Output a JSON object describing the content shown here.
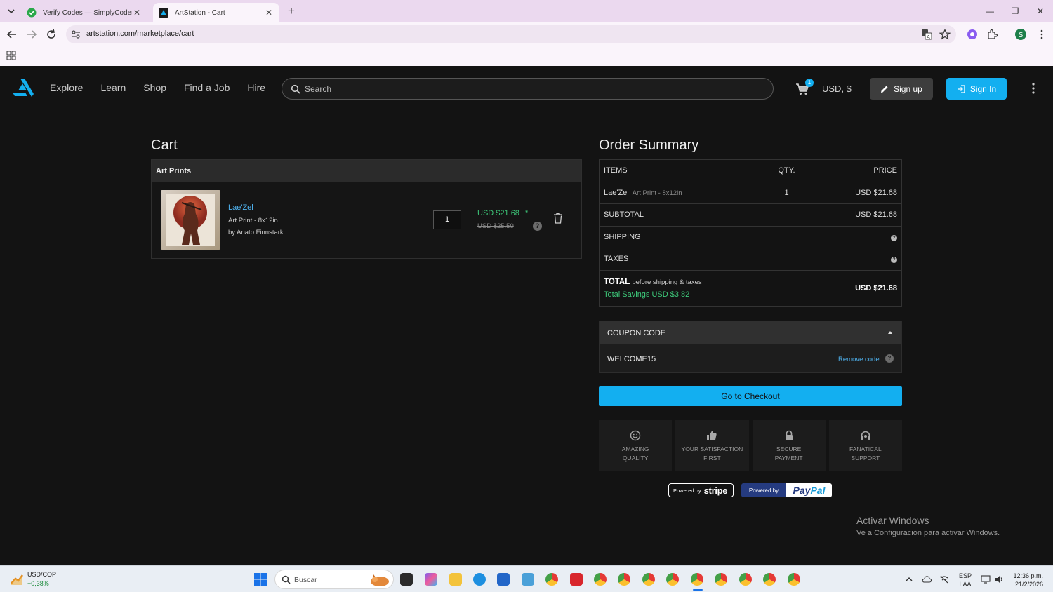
{
  "browser": {
    "tabs": [
      {
        "title": "Verify Codes — SimplyCodes",
        "active": false
      },
      {
        "title": "ArtStation - Cart",
        "active": true
      }
    ],
    "url": "artstation.com/marketplace/cart"
  },
  "header": {
    "nav": [
      "Explore",
      "Learn",
      "Shop",
      "Find a Job",
      "Hire"
    ],
    "search_placeholder": "Search",
    "cart_count": "1",
    "currency": "USD, $",
    "signup_label": "Sign up",
    "signin_label": "Sign In"
  },
  "cart": {
    "title": "Cart",
    "section_title": "Art Prints",
    "item": {
      "name": "Lae'Zel",
      "type": "Art Print - 8x12in",
      "artist": "by Anato Finnstark",
      "quantity": "1",
      "price": "USD $21.68",
      "price_star": "*",
      "original_price": "USD $25.50"
    }
  },
  "summary": {
    "title": "Order Summary",
    "headers": {
      "items": "ITEMS",
      "qty": "QTY.",
      "price": "PRICE"
    },
    "line": {
      "name": "Lae'Zel",
      "type": "Art Print - 8x12in",
      "qty": "1",
      "price": "USD $21.68"
    },
    "subtotal_label": "SUBTOTAL",
    "subtotal_value": "USD $21.68",
    "shipping_label": "SHIPPING",
    "taxes_label": "TAXES",
    "total_label": "TOTAL",
    "total_note": "before shipping & taxes",
    "savings": "Total Savings USD $3.82",
    "total_value": "USD $21.68"
  },
  "coupon": {
    "title": "COUPON CODE",
    "code": "WELCOME15",
    "remove_label": "Remove code"
  },
  "checkout_label": "Go to Checkout",
  "features": [
    {
      "icon": "smile-icon",
      "line1": "AMAZING",
      "line2": "QUALITY"
    },
    {
      "icon": "thumbs-up-icon",
      "line1": "YOUR SATISFACTION",
      "line2": "FIRST"
    },
    {
      "icon": "lock-icon",
      "line1": "SECURE",
      "line2": "PAYMENT"
    },
    {
      "icon": "headset-icon",
      "line1": "FANATICAL",
      "line2": "SUPPORT"
    }
  ],
  "payments": {
    "stripe_prefix": "Powered by",
    "stripe_brand": "stripe",
    "paypal_prefix": "Powered by",
    "paypal_brand_1": "Pay",
    "paypal_brand_2": "Pal"
  },
  "watermark": {
    "line1": "Activar Windows",
    "line2": "Ve a Configuración para activar Windows."
  },
  "taskbar": {
    "stock_name": "USD/COP",
    "stock_change": "+0,38%",
    "search_label": "Buscar",
    "lang_1": "ESP",
    "lang_2": "LAA",
    "time": "12:36 p.m.",
    "date": "21/2/2026"
  },
  "colors": {
    "accent": "#13aff0",
    "savings_green": "#3dc97a",
    "background": "#131313"
  }
}
